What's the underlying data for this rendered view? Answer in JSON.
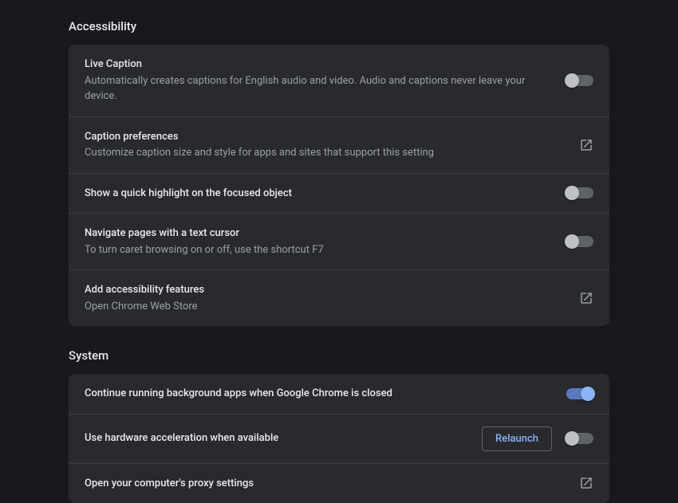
{
  "sections": {
    "accessibility": {
      "heading": "Accessibility",
      "live_caption": {
        "title": "Live Caption",
        "desc": "Automatically creates captions for English audio and video. Audio and captions never leave your device."
      },
      "caption_prefs": {
        "title": "Caption preferences",
        "desc": "Customize caption size and style for apps and sites that support this setting"
      },
      "focus_highlight": {
        "title": "Show a quick highlight on the focused object"
      },
      "caret_browsing": {
        "title": "Navigate pages with a text cursor",
        "desc": "To turn caret browsing on or off, use the shortcut F7"
      },
      "add_features": {
        "title": "Add accessibility features",
        "desc": "Open Chrome Web Store"
      }
    },
    "system": {
      "heading": "System",
      "background_apps": {
        "title": "Continue running background apps when Google Chrome is closed"
      },
      "hw_accel": {
        "title": "Use hardware acceleration when available",
        "relaunch_label": "Relaunch"
      },
      "proxy": {
        "title": "Open your computer's proxy settings"
      }
    }
  }
}
